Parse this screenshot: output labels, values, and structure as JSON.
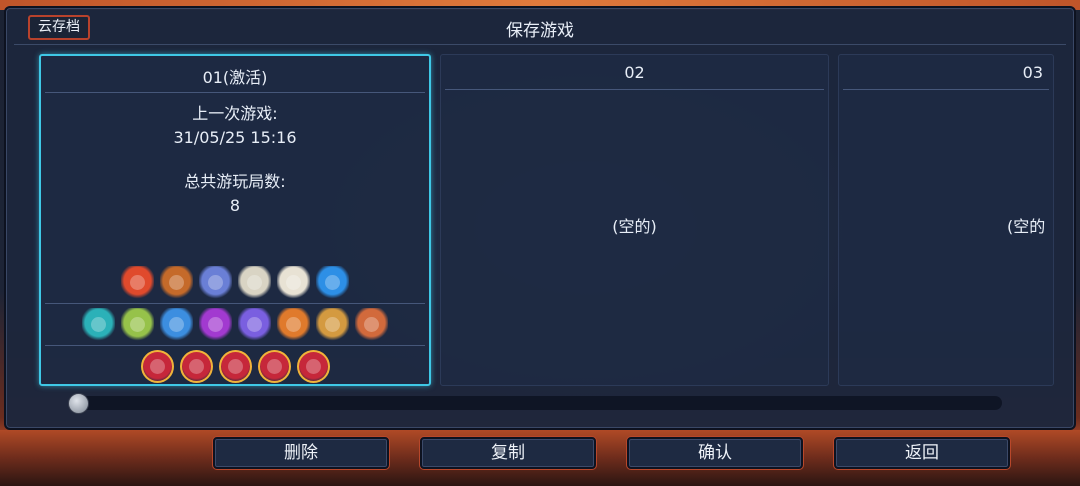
{
  "header": {
    "title": "保存游戏",
    "cloud_button": "云存档"
  },
  "slots": [
    {
      "title": "01(激活)",
      "last_played_label": "上一次游戏:",
      "last_played_value": "31/05/25 15:16",
      "runs_label": "总共游玩局数:",
      "runs_value": "8"
    },
    {
      "title": "02",
      "empty_label": "(空的)"
    },
    {
      "title": "03",
      "empty_label": "(空的"
    }
  ],
  "slot1_icons": {
    "row1": [
      "red-pot-icon",
      "orange-bag-icon",
      "blue-scroll-icon",
      "white-tool-icon",
      "dice-icon",
      "blue-orb-icon"
    ],
    "row2": [
      "teal-rune-icon",
      "green-bone-icon",
      "blue-arrow-icon",
      "purple-slash-icon",
      "violet-gem-icon",
      "orange-amulet-icon",
      "horn-icon",
      "spider-icon"
    ],
    "row3": [
      "red-eye-icon",
      "red-eye-icon",
      "red-eye-icon",
      "red-eye-icon",
      "red-eye-icon"
    ]
  },
  "icon_colors": {
    "row1": [
      "#e04a2c",
      "#c56a2a",
      "#6a7fd6",
      "#d9d4c4",
      "#e8e2d4",
      "#2d8fe6"
    ],
    "row2": [
      "#2bb1b8",
      "#96c24a",
      "#3c8ee0",
      "#a23ad0",
      "#7a5fe0",
      "#e07a2c",
      "#d49a40",
      "#d26a3c"
    ],
    "row3": [
      "#c6273a",
      "#c6273a",
      "#c6273a",
      "#c6273a",
      "#c6273a"
    ]
  },
  "buttons": {
    "delete": "删除",
    "copy": "复制",
    "confirm": "确认",
    "back": "返回"
  },
  "colors": {
    "active_border": "#3fc8e6",
    "accent_red": "#b8422c"
  }
}
